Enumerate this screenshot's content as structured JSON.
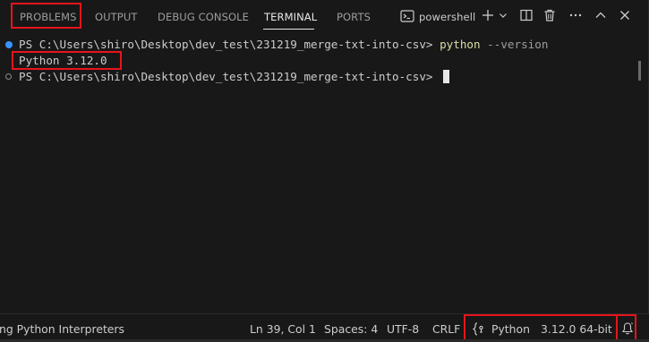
{
  "tabs": {
    "problems": "PROBLEMS",
    "output": "OUTPUT",
    "debug_console": "DEBUG CONSOLE",
    "terminal": "TERMINAL",
    "ports": "PORTS"
  },
  "toolbar": {
    "shell_name": "powershell",
    "terminal_icon": "terminal-icon",
    "add_icon": "plus-icon",
    "dropdown_icon": "chevron-down-icon",
    "split_icon": "split-editor-icon",
    "delete_icon": "trash-icon",
    "more_icon": "ellipsis-icon",
    "maximize_icon": "chevron-up-icon",
    "close_icon": "close-icon"
  },
  "terminal": {
    "line1_prompt": "PS C:\\Users\\shiro\\Desktop\\dev_test\\231219_merge-txt-into-csv> ",
    "line1_cmd": "python",
    "line1_arg": " --version",
    "line2_output": "Python 3.12.0",
    "line3_prompt": "PS C:\\Users\\shiro\\Desktop\\dev_test\\231219_merge-txt-into-csv> "
  },
  "status": {
    "left_text": "ng Python Interpreters",
    "position": "Ln 39, Col 1",
    "spaces": "Spaces: 4",
    "encoding": "UTF-8",
    "eol": "CRLF",
    "language_icon": "braces-icon",
    "language": "Python",
    "interpreter": "3.12.0 64-bit",
    "notification_icon": "bell-icon"
  },
  "colors": {
    "highlight": "#e8141b",
    "accent_blue": "#3794ff",
    "command_yellow": "#dcdcaa"
  }
}
